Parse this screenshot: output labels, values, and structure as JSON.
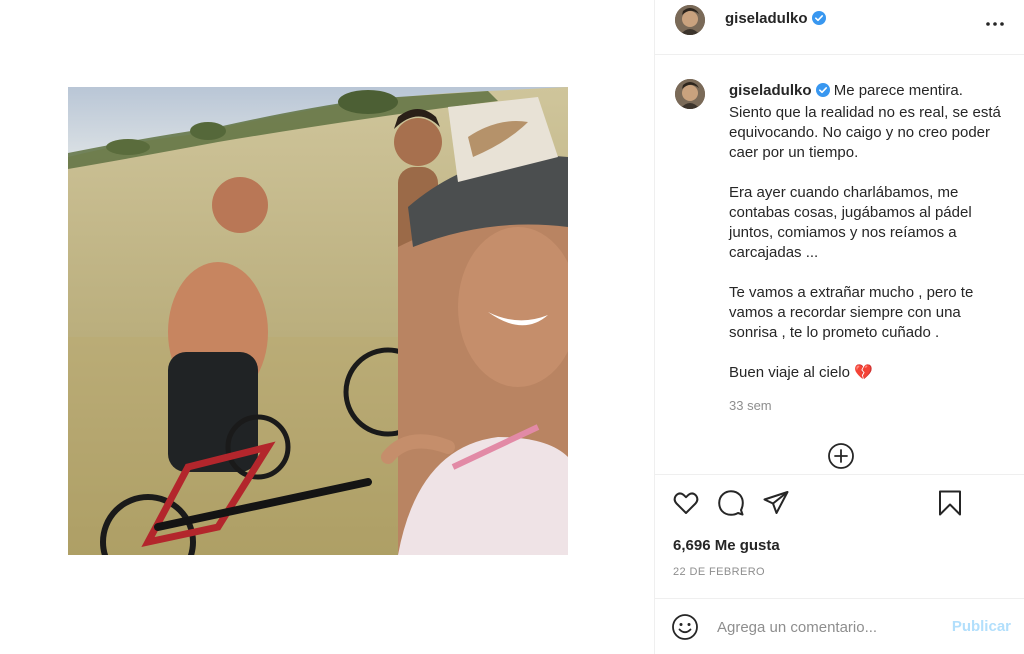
{
  "post": {
    "username": "giseladulko",
    "verified": true,
    "more_icon": "more-horizontal-icon"
  },
  "caption": {
    "username": "giseladulko",
    "first_line": "Me parece mentira. Siento que la realidad no es real, se está equivocando. No caigo y no creo poder caer por un tiempo.",
    "paragraph2": "Era ayer cuando charlábamos, me contabas cosas, jugábamos al pádel juntos, comiamos y nos reíamos a carcajadas ...",
    "paragraph3": "Te vamos a extrañar mucho , pero te vamos a recordar siempre con una sonrisa , te lo prometo cuñado .",
    "paragraph4": "Buen viaje al cielo 💔",
    "time_ago": "33 sem"
  },
  "actions": {
    "like_icon": "heart-icon",
    "comment_icon": "comment-icon",
    "share_icon": "paper-plane-icon",
    "save_icon": "bookmark-icon",
    "load_more_icon": "plus-circle-icon"
  },
  "stats": {
    "likes": "6,696 Me gusta",
    "date": "22 DE FEBRERO"
  },
  "comment": {
    "placeholder": "Agrega un comentario...",
    "post_label": "Publicar",
    "emoji_icon": "smiley-icon"
  },
  "colors": {
    "verified_blue": "#3897f0",
    "post_button_disabled": "#b2dffc",
    "secondary_text": "#8e8e8e",
    "border": "#efefef"
  }
}
